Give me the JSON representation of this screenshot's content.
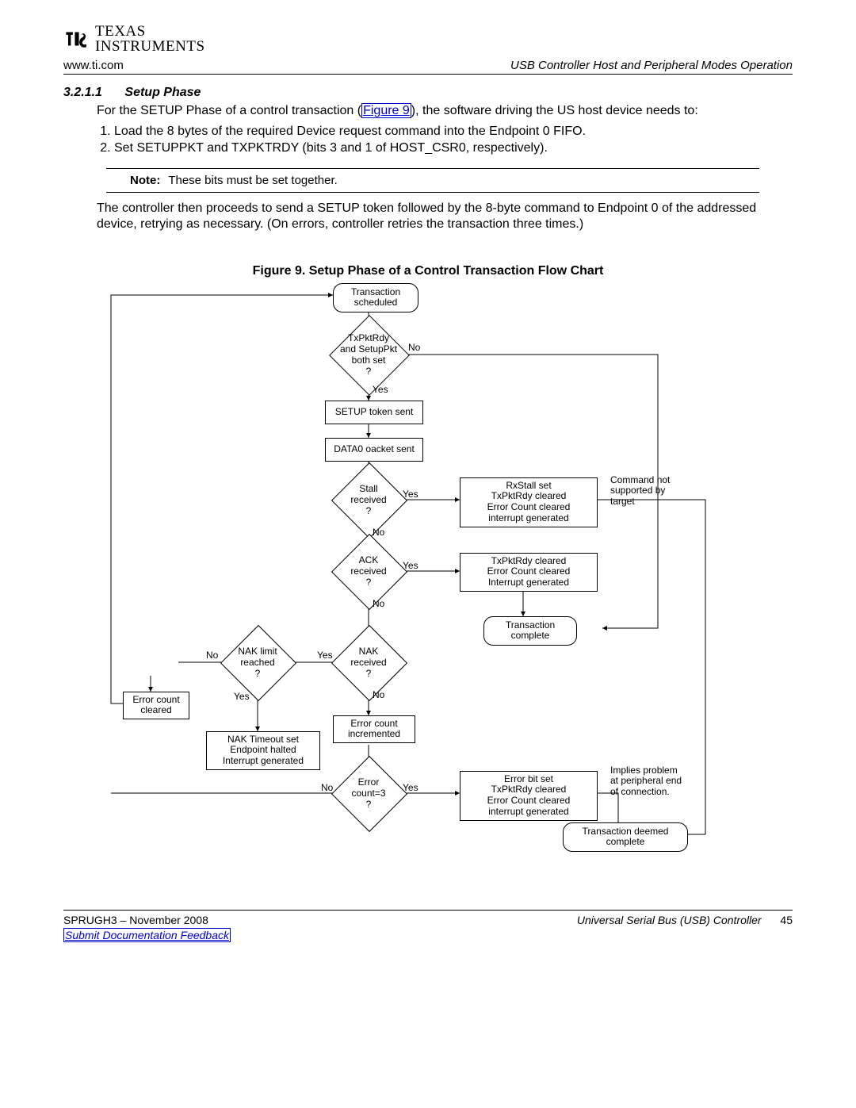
{
  "header": {
    "logo_line1": "TEXAS",
    "logo_line2": "INSTRUMENTS",
    "url": "www.ti.com",
    "doc_section": "USB Controller Host and Peripheral Modes Operation"
  },
  "section": {
    "number": "3.2.1.1",
    "title": "Setup Phase",
    "intro_a": "For the SETUP Phase of a control transaction (",
    "figlink": "Figure 9",
    "intro_b": "), the software driving the US host device needs to:",
    "step1": "Load the 8 bytes of the required Device request command into the Endpoint 0 FIFO.",
    "step2": "Set SETUPPKT and TXPKTRDY (bits 3 and 1 of HOST_CSR0, respectively).",
    "note_label": "Note:",
    "note_text": "These bits must be set together.",
    "after_note": "The controller then proceeds to send a SETUP token followed by the 8-byte command to Endpoint 0 of the addressed device, retrying as necessary. (On errors, controller retries the transaction three times.)"
  },
  "figure": {
    "caption": "Figure 9. Setup Phase of a Control Transaction Flow Chart",
    "nodes": {
      "start": "Transaction\nscheduled",
      "d1": "TxPktRdy\nand SetupPkt\nboth set\n?",
      "b1": "SETUP token sent",
      "b2": "DATA0 oacket sent",
      "d2": "Stall\nreceived\n?",
      "d3": "ACK\nreceived\n?",
      "d4": "NAK\nreceived\n?",
      "d5": "NAK limit\nreached\n?",
      "b_errclr": "Error count\ncleared",
      "b_naktimeout": "NAK Timeout set\nEndpoint halted\nInterrupt generated",
      "b_errinc": "Error count\nincremented",
      "d6": "Error\ncount=3\n?",
      "b_rxstall": "RxStall set\nTxPktRdy cleared\nError Count cleared\ninterrupt generated",
      "b_ackbox": "TxPktRdy cleared\nError Count cleared\nInterrupt generated",
      "r_transcomplete": "Transaction\ncomplete",
      "b_errbit": "Error bit set\nTxPktRdy cleared\nError Count cleared\ninterrupt generated",
      "r_deemed": "Transaction deemed\ncomplete",
      "side_cmd": "Command not\nsupported by\ntarget",
      "side_problem": "Implies problem\nat peripheral end\nof connection."
    },
    "labels": {
      "yes": "Yes",
      "no": "No"
    }
  },
  "footer": {
    "left": "SPRUGH3 – November 2008",
    "right": "Universal Serial Bus (USB) Controller",
    "page": "45",
    "feedback": "Submit Documentation Feedback"
  }
}
